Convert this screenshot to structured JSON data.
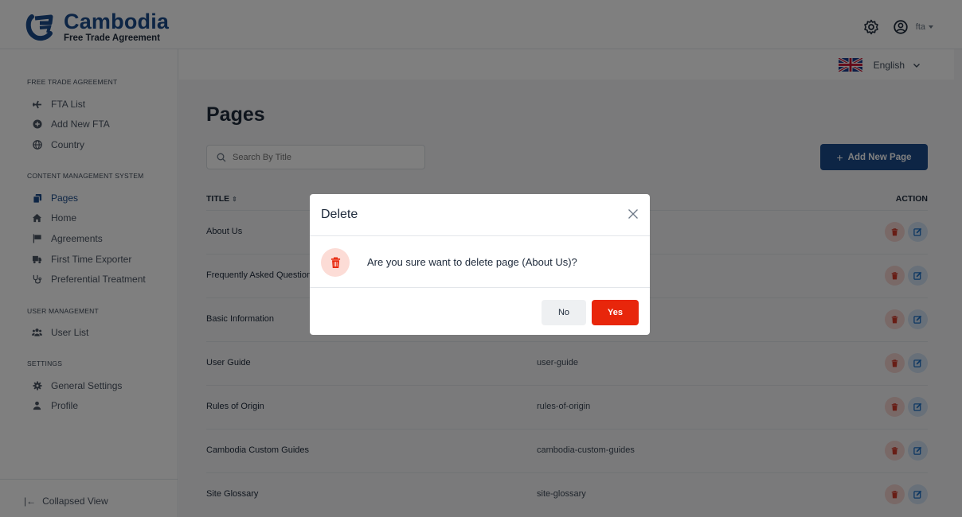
{
  "brand": {
    "name": "Cambodia",
    "subtitle": "Free Trade Agreement",
    "accent": "#1b4b8a"
  },
  "header": {
    "username": "fta",
    "settings_icon": "gear-icon",
    "user_icon": "user-circle-icon"
  },
  "language": {
    "selected": "English",
    "flag": "uk-flag-icon"
  },
  "sidebar": {
    "sections": [
      {
        "title": "FREE TRADE AGREEMENT",
        "items": [
          {
            "label": "FTA List",
            "icon": "plane-icon"
          },
          {
            "label": "Add New FTA",
            "icon": "plus-circle-icon"
          },
          {
            "label": "Country",
            "icon": "globe-icon"
          }
        ]
      },
      {
        "title": "CONTENT MANAGEMENT SYSTEM",
        "items": [
          {
            "label": "Pages",
            "icon": "pages-icon",
            "active": true
          },
          {
            "label": "Home",
            "icon": "home-icon"
          },
          {
            "label": "Agreements",
            "icon": "flag-icon"
          },
          {
            "label": "First Time Exporter",
            "icon": "truck-icon"
          },
          {
            "label": "Preferential Treatment",
            "icon": "stethoscope-icon"
          }
        ]
      },
      {
        "title": "USER MANAGEMENT",
        "items": [
          {
            "label": "User List",
            "icon": "users-icon"
          }
        ]
      },
      {
        "title": "SETTINGS",
        "items": [
          {
            "label": "General Settings",
            "icon": "cog-icon"
          },
          {
            "label": "Profile",
            "icon": "person-icon"
          }
        ]
      }
    ],
    "collapse_label": "Collapsed View"
  },
  "main": {
    "title": "Pages",
    "search_placeholder": "Search By Title",
    "add_button": "Add New Page",
    "columns": {
      "title": "TITLE",
      "action": "ACTION"
    },
    "rows": [
      {
        "title": "About Us",
        "slug": ""
      },
      {
        "title": "Frequently Asked Questions",
        "slug": ""
      },
      {
        "title": "Basic Information",
        "slug": ""
      },
      {
        "title": "User Guide",
        "slug": "user-guide"
      },
      {
        "title": "Rules of Origin",
        "slug": "rules-of-origin"
      },
      {
        "title": "Cambodia Custom Guides",
        "slug": "cambodia-custom-guides"
      },
      {
        "title": "Site Glossary",
        "slug": "site-glossary"
      }
    ]
  },
  "modal": {
    "title": "Delete",
    "message": "Are you sure want to delete page (About Us)?",
    "no_label": "No",
    "yes_label": "Yes",
    "danger_color": "#e8260b"
  }
}
